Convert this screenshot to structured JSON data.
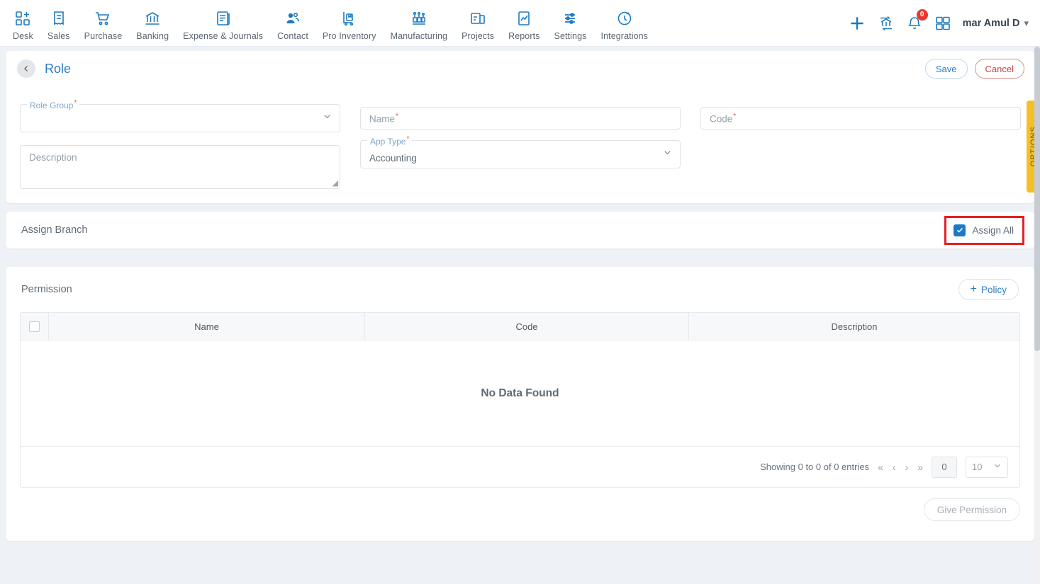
{
  "topnav": {
    "items": [
      {
        "label": "Desk",
        "icon": "desk-grid-plus-icon"
      },
      {
        "label": "Sales",
        "icon": "sales-receipt-icon"
      },
      {
        "label": "Purchase",
        "icon": "purchase-cart-icon"
      },
      {
        "label": "Banking",
        "icon": "banking-bank-icon"
      },
      {
        "label": "Expense & Journals",
        "icon": "expense-journal-icon"
      },
      {
        "label": "Contact",
        "icon": "contact-people-icon"
      },
      {
        "label": "Pro Inventory",
        "icon": "pro-inventory-trolley-icon"
      },
      {
        "label": "Manufacturing",
        "icon": "manufacturing-factory-icon"
      },
      {
        "label": "Projects",
        "icon": "projects-clipboard-icon"
      },
      {
        "label": "Reports",
        "icon": "reports-chart-icon"
      },
      {
        "label": "Settings",
        "icon": "settings-sliders-icon"
      },
      {
        "label": "Integrations",
        "icon": "integrations-plug-icon"
      }
    ],
    "actions": {
      "add_icon": "plus-icon",
      "switch_company_icon": "bank-transfer-icon",
      "notifications_icon": "bell-icon",
      "notifications_count": "0",
      "apps_icon": "apps-grid-icon"
    },
    "user": {
      "name": "mar Amul D",
      "caret_icon": "chevron-down-icon"
    }
  },
  "header": {
    "back_icon": "chevron-left-icon",
    "title": "Role",
    "save_label": "Save",
    "cancel_label": "Cancel"
  },
  "form": {
    "role_group": {
      "label": "Role Group",
      "required": "*",
      "value": "",
      "chevron_icon": "chevron-down-icon"
    },
    "description": {
      "placeholder": "Description",
      "value": ""
    },
    "name": {
      "placeholder": "Name",
      "required": "*",
      "value": ""
    },
    "app_type": {
      "label": "App Type",
      "required": "*",
      "value": "Accounting",
      "chevron_icon": "chevron-down-icon"
    },
    "code": {
      "placeholder": "Code",
      "required": "*",
      "value": ""
    }
  },
  "options_tab": {
    "label": "OPTIONS"
  },
  "assign_branch": {
    "title": "Assign Branch",
    "assign_all_label": "Assign All",
    "assign_all_checked": true,
    "highlight_color": "#e41f26"
  },
  "permission": {
    "title": "Permission",
    "policy_button": {
      "label": "Policy",
      "icon": "plus-icon"
    },
    "table": {
      "columns": [
        "Name",
        "Code",
        "Description"
      ],
      "select_all_checked": false,
      "rows": [],
      "empty_message": "No Data Found"
    },
    "pagination": {
      "showing": "Showing 0 to 0 of 0 entries",
      "first_icon": "double-chevron-left-icon",
      "prev_icon": "chevron-left-icon",
      "next_icon": "chevron-right-icon",
      "last_icon": "double-chevron-right-icon",
      "page_value": "0",
      "page_size": "10",
      "page_size_chevron": "chevron-down-icon"
    },
    "give_permission_label": "Give Permission"
  },
  "colors": {
    "accent_blue": "#2e7cc4",
    "icon_blue": "#1f7ac0",
    "danger_red": "#cb4040",
    "highlight_red": "#e41f26",
    "options_yellow": "#f6bf26",
    "page_bg": "#eef2f6"
  }
}
